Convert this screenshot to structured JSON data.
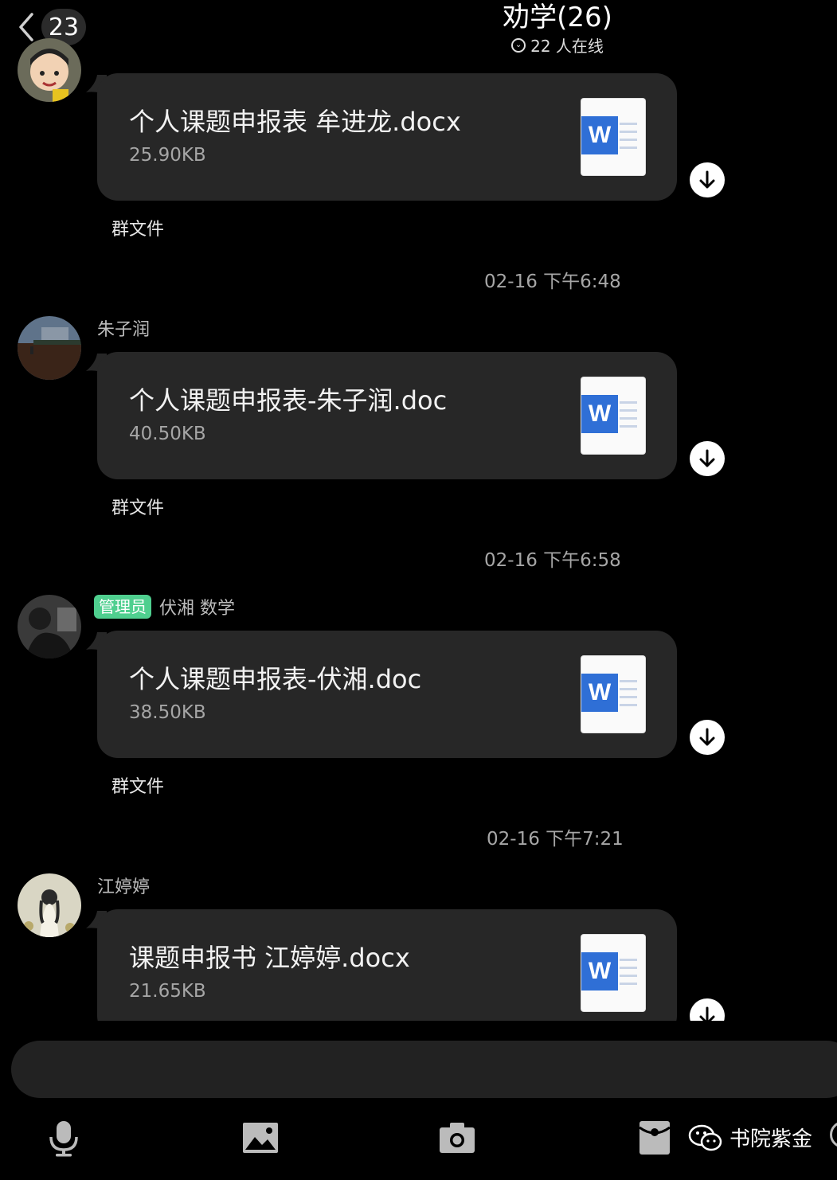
{
  "header": {
    "back_count": "23",
    "title": "劝学(26)",
    "online": "22 人在线"
  },
  "messages": [
    {
      "sender": "",
      "badge": "",
      "file_name": "个人课题申报表  牟进龙.docx",
      "file_size": "25.90KB",
      "group_file": "群文件",
      "timestamp": "02-16 下午6:48"
    },
    {
      "sender": "朱子润",
      "badge": "",
      "file_name": "个人课题申报表-朱子润.doc",
      "file_size": "40.50KB",
      "group_file": "群文件",
      "timestamp": "02-16 下午6:58"
    },
    {
      "sender": "伏湘 数学",
      "badge": "管理员",
      "file_name": "个人课题申报表-伏湘.doc",
      "file_size": "38.50KB",
      "group_file": "群文件",
      "timestamp": "02-16 下午7:21"
    },
    {
      "sender": "江婷婷",
      "badge": "",
      "file_name": "课题申报书 江婷婷.docx",
      "file_size": "21.65KB",
      "group_file": "",
      "timestamp": ""
    }
  ],
  "file_icon_letter": "W",
  "toolbar": {
    "icons": [
      "microphone-icon",
      "image-icon",
      "camera-icon",
      "red-packet-icon"
    ]
  },
  "watermark": "书院紫金",
  "colors": {
    "background": "#000000",
    "bubble": "#272727",
    "admin_badge": "#4fcf8f",
    "word_blue": "#2f6fd6"
  }
}
